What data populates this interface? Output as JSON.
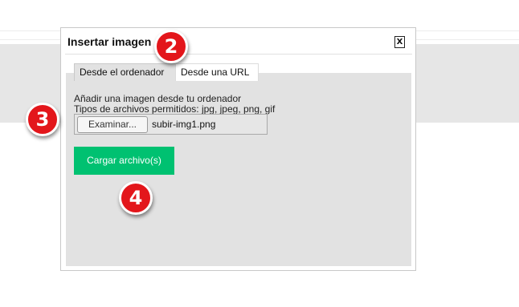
{
  "dialog": {
    "title": "Insertar imagen",
    "close_label": "X",
    "tabs": [
      {
        "label": "Desde el ordenador",
        "active": true
      },
      {
        "label": "Desde una URL",
        "active": false
      }
    ],
    "panel": {
      "instruction": "Añadir una imagen desde tu ordenador",
      "allowed_types": "Tipos de archivos permitidos: jpg, jpeg, png, gif",
      "browse_label": "Examinar...",
      "selected_file": "subir-img1.png",
      "upload_label": "Cargar archivo(s)"
    }
  },
  "step_badges": [
    "2",
    "3",
    "4"
  ],
  "colors": {
    "upload_button": "#00c171",
    "badge": "#e3161b",
    "panel_bg": "#e2e2e2"
  }
}
